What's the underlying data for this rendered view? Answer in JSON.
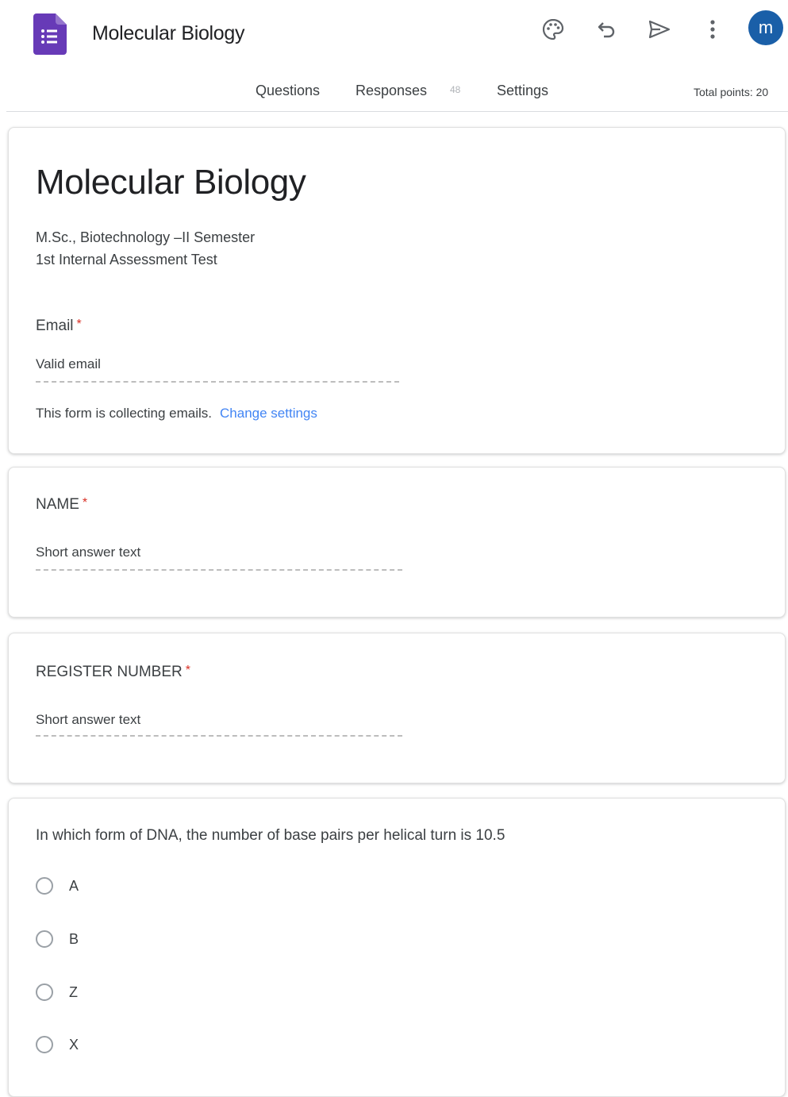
{
  "header": {
    "app_title": "Molecular Biology",
    "avatar_letter": "m",
    "icons": [
      "palette-icon",
      "undo-icon",
      "send-icon",
      "more-vert-icon"
    ]
  },
  "tabs": {
    "questions": "Questions",
    "responses": "Responses",
    "responses_count": "48",
    "settings": "Settings",
    "total_points": "Total points: 20"
  },
  "form": {
    "title": "Molecular Biology",
    "description_line1": "M.Sc., Biotechnology –II Semester",
    "description_line2": "1st Internal Assessment Test",
    "email_label": "Email",
    "email_placeholder": "Valid email",
    "collecting_note": "This form is collecting emails.",
    "change_settings": "Change settings"
  },
  "questions": [
    {
      "title": "NAME",
      "placeholder": "Short answer text"
    },
    {
      "title": "REGISTER NUMBER",
      "placeholder": "Short answer text"
    }
  ],
  "mcq": {
    "title": "In which form of DNA, the number of base pairs per  helical turn is 10.5",
    "options": [
      "A",
      "B",
      "Z",
      "X"
    ]
  },
  "colors": {
    "forms_purple": "#673ab7",
    "required_red": "#d93025",
    "link_blue": "#4285f4",
    "avatar_blue": "#1a5fa8"
  }
}
